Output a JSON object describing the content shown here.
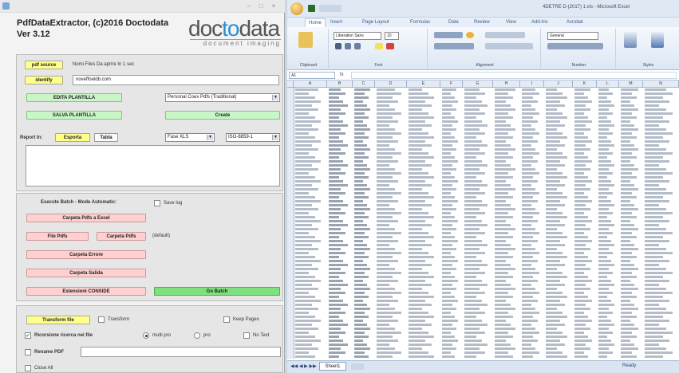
{
  "app": {
    "title": "PdfDataExtractor, (c)2016 Doctodata",
    "version": "Ver 3.12",
    "window_controls": [
      "–",
      "□",
      "×"
    ],
    "logo": {
      "part1": "doc",
      "part2": "to",
      "part3": "data",
      "tagline": "document imaging"
    }
  },
  "top_panel": {
    "pdf_source_button": "pdf source",
    "pdf_source_info": "Nomi Files Da aprire In 1 sec",
    "identify_button": "identify",
    "identify_value": "noveffoeldb.com",
    "edit_button": "EDITA PLANTILLA",
    "profile_select": "Personal Coex Pdfs (Traditional)",
    "save_button": "SALVA PLANTILLA",
    "create_button": "Create",
    "output_label": "Report In:",
    "export_button": "Esporta",
    "table_button": "Tabla",
    "format_select": "Fase XLS",
    "encoding_select": "ISO-8859-1",
    "log_text": ""
  },
  "batch_panel": {
    "title": "Esecute Batch - Mode Automatic:",
    "save_log_label": "Save log",
    "load_files_button": "Carpeta Pdfs a Excel",
    "files_button": "File Pdfs",
    "folder_button": "Carpeta Pdfs",
    "folder_info": "(default)",
    "errors_button": "Carpeta Errore",
    "done_button": "Carpeta Salida",
    "drop_button": "Estensioni CONSIDE",
    "go_button": "Go Batch"
  },
  "bottom_panel": {
    "transform_button": "Transform file",
    "transform_label": "Transform",
    "keep_pages_label": "Keep Pages",
    "recursive_label": "Ricorsione ricerca nei file",
    "radio_native": "multi pro",
    "radio_ocr": "pro",
    "no_text_label": "No Text",
    "rename_label": "Rename PDF",
    "close_label": "Close All",
    "rename_value": ""
  },
  "excel": {
    "title": "4DETRE D-(2017) 1.xls - Microsoft Excel",
    "tabs": [
      "Home",
      "Insert",
      "Page Layout",
      "Formulas",
      "Data",
      "Review",
      "View",
      "Add-Ins",
      "Acrobat"
    ],
    "ribbon_groups": [
      "Clipboard",
      "Font",
      "Alignment",
      "Number",
      "Styles"
    ],
    "font_name": "Liberation Sans",
    "font_size": "10",
    "number_format": "General",
    "name_box": "A1",
    "columns": [
      "A",
      "B",
      "C",
      "D",
      "E",
      "F",
      "G",
      "H",
      "I",
      "J",
      "K",
      "L",
      "M",
      "N"
    ],
    "sheet_tab": "Sheet1",
    "status": "Ready"
  }
}
